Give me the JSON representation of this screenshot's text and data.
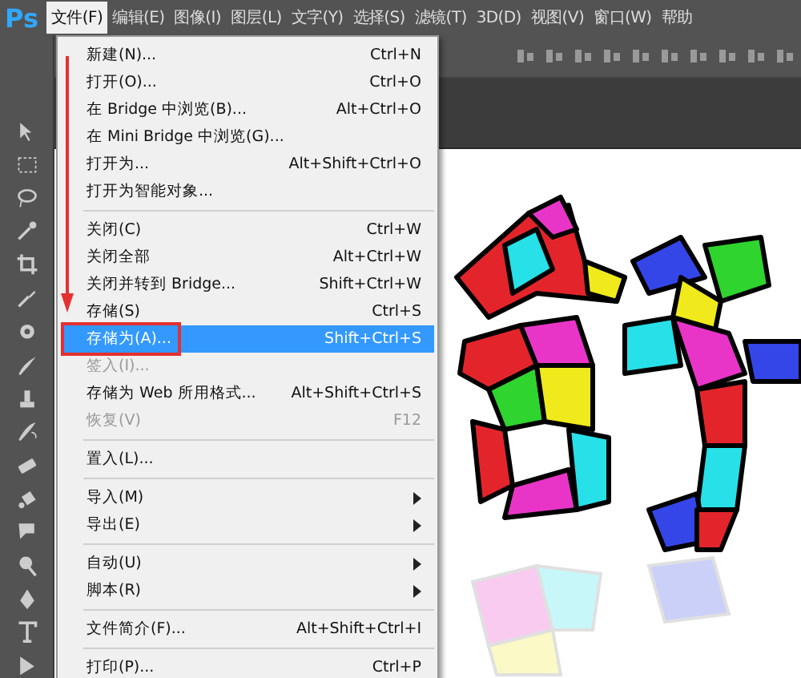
{
  "app": {
    "logo": "Ps"
  },
  "menubar": [
    {
      "label": "文件(F)",
      "selected": true
    },
    {
      "label": "编辑(E)",
      "selected": false
    },
    {
      "label": "图像(I)",
      "selected": false
    },
    {
      "label": "图层(L)",
      "selected": false
    },
    {
      "label": "文字(Y)",
      "selected": false
    },
    {
      "label": "选择(S)",
      "selected": false
    },
    {
      "label": "滤镜(T)",
      "selected": false
    },
    {
      "label": "3D(D)",
      "selected": false
    },
    {
      "label": "视图(V)",
      "selected": false
    },
    {
      "label": "窗口(W)",
      "selected": false
    },
    {
      "label": "帮助",
      "selected": false
    }
  ],
  "file_menu": [
    {
      "kind": "item",
      "label": "新建(N)...",
      "shortcut": "Ctrl+N",
      "disabled": false,
      "selected": false
    },
    {
      "kind": "item",
      "label": "打开(O)...",
      "shortcut": "Ctrl+O",
      "disabled": false,
      "selected": false
    },
    {
      "kind": "item",
      "label": "在 Bridge 中浏览(B)...",
      "shortcut": "Alt+Ctrl+O",
      "disabled": false,
      "selected": false
    },
    {
      "kind": "item",
      "label": "在 Mini Bridge 中浏览(G)...",
      "disabled": false,
      "selected": false
    },
    {
      "kind": "item",
      "label": "打开为...",
      "shortcut": "Alt+Shift+Ctrl+O",
      "disabled": false,
      "selected": false
    },
    {
      "kind": "item",
      "label": "打开为智能对象...",
      "disabled": false,
      "selected": false
    },
    {
      "kind": "separator"
    },
    {
      "kind": "item",
      "label": "关闭(C)",
      "shortcut": "Ctrl+W",
      "disabled": false,
      "selected": false
    },
    {
      "kind": "item",
      "label": "关闭全部",
      "shortcut": "Alt+Ctrl+W",
      "disabled": false,
      "selected": false
    },
    {
      "kind": "item",
      "label": "关闭并转到 Bridge...",
      "shortcut": "Shift+Ctrl+W",
      "disabled": false,
      "selected": false
    },
    {
      "kind": "item",
      "label": "存储(S)",
      "shortcut": "Ctrl+S",
      "disabled": false,
      "selected": false
    },
    {
      "kind": "item",
      "label": "存储为(A)...",
      "shortcut": "Shift+Ctrl+S",
      "disabled": false,
      "selected": true
    },
    {
      "kind": "item",
      "label": "签入(I)...",
      "disabled": true,
      "selected": false
    },
    {
      "kind": "item",
      "label": "存储为 Web 所用格式...",
      "shortcut": "Alt+Shift+Ctrl+S",
      "disabled": false,
      "selected": false
    },
    {
      "kind": "item",
      "label": "恢复(V)",
      "shortcut": "F12",
      "disabled": true,
      "selected": false
    },
    {
      "kind": "separator"
    },
    {
      "kind": "item",
      "label": "置入(L)...",
      "disabled": false,
      "selected": false
    },
    {
      "kind": "separator"
    },
    {
      "kind": "item",
      "label": "导入(M)",
      "submenu": true,
      "disabled": false,
      "selected": false
    },
    {
      "kind": "item",
      "label": "导出(E)",
      "submenu": true,
      "disabled": false,
      "selected": false
    },
    {
      "kind": "separator"
    },
    {
      "kind": "item",
      "label": "自动(U)",
      "submenu": true,
      "disabled": false,
      "selected": false
    },
    {
      "kind": "item",
      "label": "脚本(R)",
      "submenu": true,
      "disabled": false,
      "selected": false
    },
    {
      "kind": "separator"
    },
    {
      "kind": "item",
      "label": "文件简介(F)...",
      "shortcut": "Alt+Shift+Ctrl+I",
      "disabled": false,
      "selected": false
    },
    {
      "kind": "separator"
    },
    {
      "kind": "item",
      "label": "打印(P)...",
      "shortcut": "Ctrl+P",
      "disabled": false,
      "selected": false
    }
  ]
}
